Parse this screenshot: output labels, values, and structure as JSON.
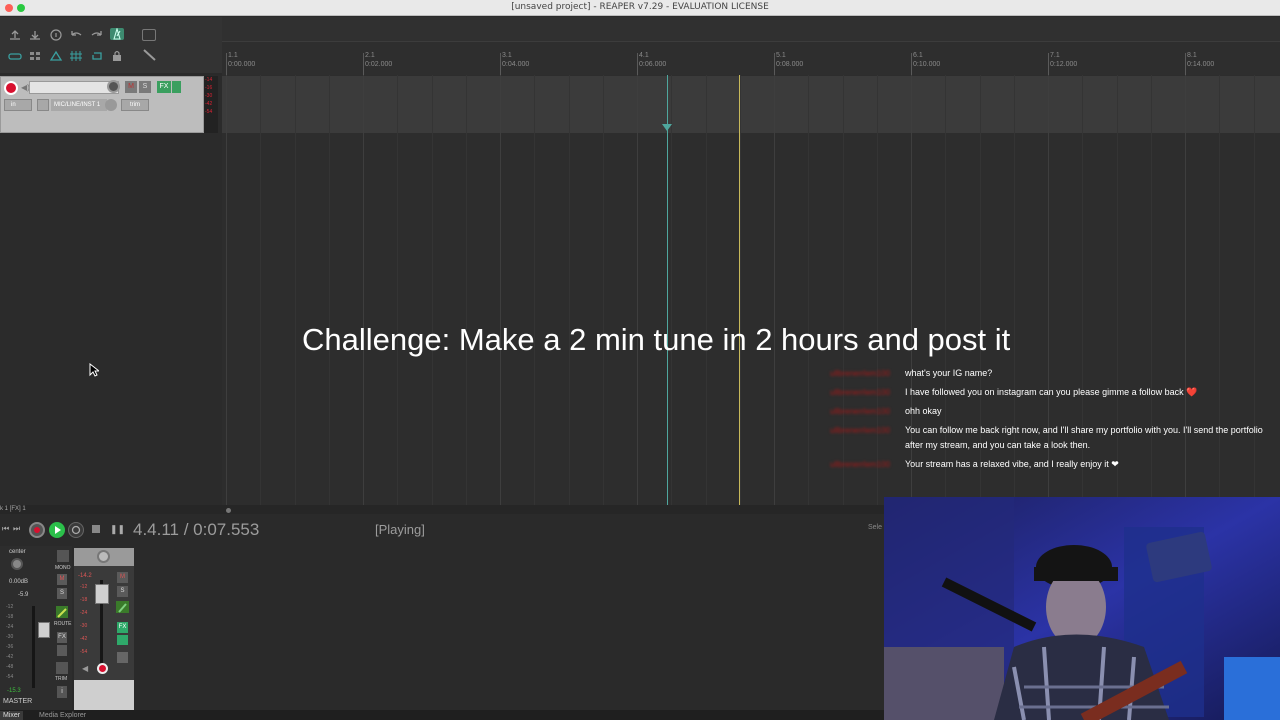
{
  "window": {
    "title": "[unsaved project] - REAPER v7.29 - EVALUATION LICENSE"
  },
  "ruler": {
    "marks": [
      {
        "bar": "1.1",
        "time": "0:00.000"
      },
      {
        "bar": "2.1",
        "time": "0:02.000"
      },
      {
        "bar": "3.1",
        "time": "0:04.000"
      },
      {
        "bar": "4.1",
        "time": "0:06.000"
      },
      {
        "bar": "5.1",
        "time": "0:08.000"
      },
      {
        "bar": "6.1",
        "time": "0:10.000"
      },
      {
        "bar": "7.1",
        "time": "0:12.000"
      },
      {
        "bar": "8.1",
        "time": "0:14.000"
      }
    ]
  },
  "track": {
    "input_label": "MIC/LINE/INST 1",
    "in_label": "in",
    "trim_label": "trim",
    "mute_label": "M",
    "solo_label": "S",
    "fx_label": "FX",
    "meter_ticks": [
      "-14",
      "-16",
      "-30",
      "-42",
      "-54"
    ]
  },
  "status_strip": {
    "text": "k 1 [FX] 1"
  },
  "overlay": {
    "title": "Challenge: Make a 2 min tune in 2 hours and post it"
  },
  "chat": {
    "messages": [
      {
        "user": "ullbrenerrlem100",
        "text": "what's your IG name?"
      },
      {
        "user": "ullbrenerrlem100",
        "text": "I have followed you on instagram can you please gimme a follow back ❤️"
      },
      {
        "user": "ullbrenerrlem100",
        "text": "ohh okay"
      },
      {
        "user": "ullbrenerrlem100",
        "text": "You can follow me back right now, and I'll share my portfolio with you. I'll send the portfolio after my stream, and you can take a look then."
      },
      {
        "user": "ullbrenerrlem100",
        "text": "Your stream has a relaxed vibe, and I really enjoy it ❤"
      }
    ]
  },
  "transport": {
    "time": "4.4.11 / 0:07.553",
    "status": "[Playing]",
    "sel_label": "Sele"
  },
  "mixer": {
    "master_label": "MASTER",
    "pan_label": "center",
    "volume_db": "0.00dB",
    "peak_left": "-5.9",
    "peak_bottom": "-15.3",
    "mono_label": "MONO",
    "route_label": "ROUTE",
    "trim_label": "TRIM",
    "track_meter_value": "-14.2",
    "master_meter_ticks": [
      "-12",
      "-18",
      "-24",
      "-30",
      "-36",
      "-42",
      "-48",
      "-54"
    ],
    "track_meter_ticks": [
      "-12",
      "-18",
      "-24",
      "-30",
      "-42",
      "-54"
    ]
  },
  "bottom_tabs": [
    {
      "label": "Mixer"
    },
    {
      "label": "Media Explorer"
    }
  ],
  "colors": {
    "accent_teal": "#4fa79e",
    "play_cursor": "#c8b95a",
    "record_red": "#d8102f",
    "play_green": "#2bbf4a",
    "chat_user": "#a51818"
  }
}
